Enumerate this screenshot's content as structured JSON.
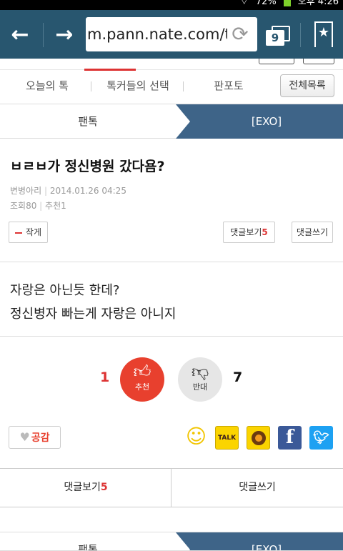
{
  "status_bar": {
    "battery": "72%",
    "time": "오후 4:26"
  },
  "browser": {
    "back_icon": "arrow-left-icon",
    "forward_icon": "arrow-right-icon",
    "url": "m.pann.nate.com/talk",
    "tab_count": "9"
  },
  "menu": {
    "items": [
      "오늘의 톡",
      "톡커들의 선택",
      "판포토"
    ],
    "full_list": "전체목록"
  },
  "breadcrumb": {
    "left": "팬톡",
    "right": "[EXO]"
  },
  "post": {
    "title": "ㅂㄹㅂ가 정신병원 갔다욤?",
    "author": "변병아리",
    "date": "2014.01.26 04:25",
    "views": "조회80",
    "recommends": "추천1",
    "author_btn": "작게",
    "view_comments": "댓글보기",
    "comment_count": "5",
    "write_comment": "댓글쓰기",
    "body": [
      "자랑은 아닌듯 한데?",
      "정신병자 빠는게 자랑은 아니지"
    ]
  },
  "vote": {
    "recommend_count": "1",
    "recommend_label": "추천",
    "oppose_label": "반대",
    "oppose_count": "7"
  },
  "share": {
    "empathy": "공감",
    "talk": "TALK"
  },
  "comments_bar": {
    "view": "댓글보기",
    "count": "5",
    "write": "댓글쓰기"
  },
  "footer_breadcrumb": {
    "left": "팬톡",
    "right": "[EXO]"
  },
  "colors": {
    "browser_bar": "#28566f",
    "crumb_active": "#3e6488",
    "accent_red": "#e8402e"
  }
}
